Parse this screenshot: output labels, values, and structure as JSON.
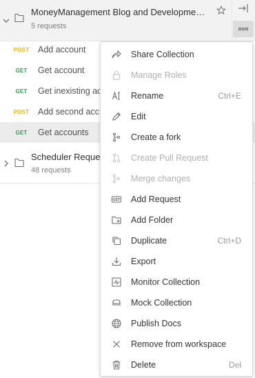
{
  "collections": [
    {
      "name": "MoneyManagement Blog and Developme…",
      "count": "5 requests",
      "expanded": true
    },
    {
      "name": "Scheduler Reque",
      "count": "48 requests",
      "expanded": false
    }
  ],
  "requests": [
    {
      "method": "POST",
      "name": "Add account"
    },
    {
      "method": "GET",
      "name": "Get account"
    },
    {
      "method": "GET",
      "name": "Get inexisting ac"
    },
    {
      "method": "POST",
      "name": "Add second acc"
    },
    {
      "method": "GET",
      "name": "Get accounts"
    }
  ],
  "menu": {
    "items": [
      {
        "label": "Share Collection",
        "shortcut": "",
        "icon": "share-icon",
        "disabled": false
      },
      {
        "label": "Manage Roles",
        "shortcut": "",
        "icon": "lock-icon",
        "disabled": true
      },
      {
        "label": "Rename",
        "shortcut": "Ctrl+E",
        "icon": "rename-icon",
        "disabled": false
      },
      {
        "label": "Edit",
        "shortcut": "",
        "icon": "pencil-icon",
        "disabled": false
      },
      {
        "label": "Create a fork",
        "shortcut": "",
        "icon": "fork-icon",
        "disabled": false
      },
      {
        "label": "Create Pull Request",
        "shortcut": "",
        "icon": "pull-request-icon",
        "disabled": true
      },
      {
        "label": "Merge changes",
        "shortcut": "",
        "icon": "merge-icon",
        "disabled": true
      },
      {
        "label": "Add Request",
        "shortcut": "",
        "icon": "get-request-icon",
        "disabled": false
      },
      {
        "label": "Add Folder",
        "shortcut": "",
        "icon": "folder-plus-icon",
        "disabled": false
      },
      {
        "label": "Duplicate",
        "shortcut": "Ctrl+D",
        "icon": "duplicate-icon",
        "disabled": false
      },
      {
        "label": "Export",
        "shortcut": "",
        "icon": "export-icon",
        "disabled": false
      },
      {
        "label": "Monitor Collection",
        "shortcut": "",
        "icon": "monitor-icon",
        "disabled": false
      },
      {
        "label": "Mock Collection",
        "shortcut": "",
        "icon": "mock-server-icon",
        "disabled": false
      },
      {
        "label": "Publish Docs",
        "shortcut": "",
        "icon": "globe-icon",
        "disabled": false
      },
      {
        "label": "Remove from workspace",
        "shortcut": "",
        "icon": "close-icon",
        "disabled": false
      },
      {
        "label": "Delete",
        "shortcut": "Del",
        "icon": "trash-icon",
        "disabled": false
      }
    ]
  },
  "colors": {
    "post": "#f0b400",
    "get": "#2e9e4e",
    "disabled_text": "#b0b0b0",
    "icon": "#6b6b6b"
  }
}
